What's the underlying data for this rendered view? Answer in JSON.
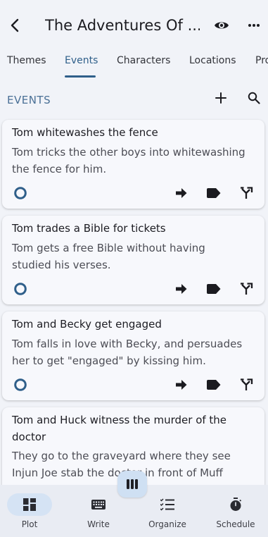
{
  "header": {
    "title": "The Adventures Of ..."
  },
  "tabs": [
    {
      "label": "Themes"
    },
    {
      "label": "Events"
    },
    {
      "label": "Characters"
    },
    {
      "label": "Locations"
    },
    {
      "label": "Pro"
    }
  ],
  "section": {
    "title": "EVENTS"
  },
  "events": [
    {
      "title": "Tom whitewashes the fence",
      "description_lines": [
        "Tom tricks the other boys into whitewashing",
        "the fence for him."
      ]
    },
    {
      "title": "Tom trades a Bible for tickets",
      "description_lines": [
        "Tom gets a free Bible without having",
        "studied his verses."
      ]
    },
    {
      "title": "Tom and Becky get engaged",
      "description_lines": [
        "Tom falls in love with Becky, and persuades",
        "her to get \"engaged\" by kissing him."
      ]
    },
    {
      "title_lines": [
        "Tom and Huck witness the murder of the",
        "doctor"
      ],
      "description_lines": [
        "They go to the graveyard where they see",
        "Injun Joe stab the doctor in front of Muff"
      ]
    }
  ],
  "bottom_nav": [
    {
      "label": "Plot",
      "icon": "grid-icon",
      "active": true
    },
    {
      "label": "Write",
      "icon": "keyboard-icon",
      "active": false
    },
    {
      "label": "Organize",
      "icon": "list-icon",
      "active": false
    },
    {
      "label": "Schedule",
      "icon": "timer-icon",
      "active": false
    }
  ],
  "colors": {
    "accent": "#2f5f8a",
    "section_title": "#4a7096",
    "background": "#f1f3f8",
    "card": "#f7f8fc",
    "nav_active_pill": "#d5e3f4"
  }
}
